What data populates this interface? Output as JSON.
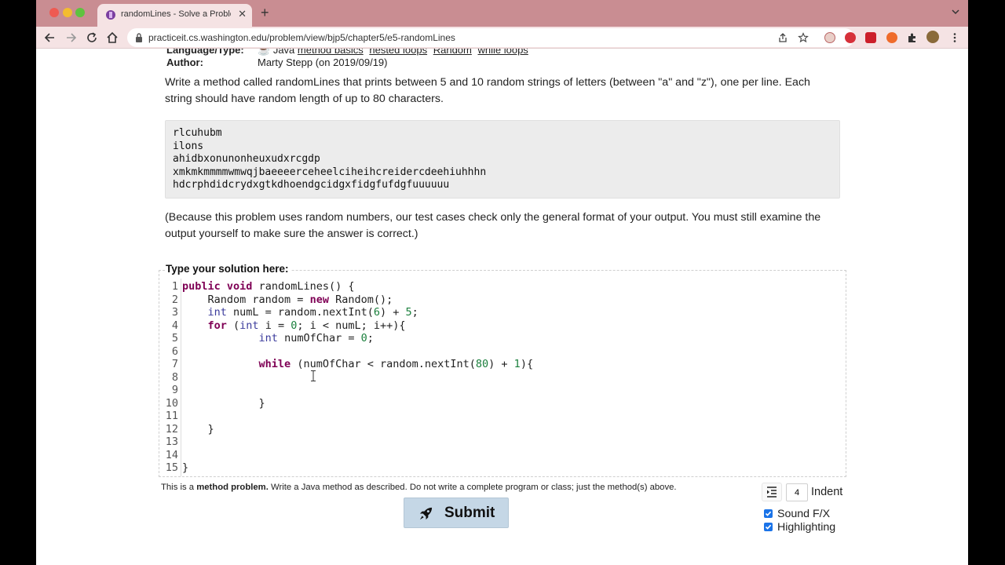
{
  "browser": {
    "tab_title": "randomLines - Solve a Problem",
    "tab_close": "✕",
    "new_tab": "+",
    "url": "practiceit.cs.washington.edu/problem/view/bjp5/chapter5/e5-randomLines",
    "icons": [
      "back-icon",
      "forward-icon",
      "reload-icon",
      "home-icon",
      "lock-icon",
      "share-icon",
      "star-icon",
      "extension-icons",
      "puzzle-icon",
      "profile-avatar",
      "kebab-menu-icon"
    ]
  },
  "problem": {
    "language_label": "Language/Type:",
    "language_value": "Java",
    "tags": [
      "method basics",
      "nested loops",
      "Random",
      "while loops"
    ],
    "author_label": "Author:",
    "author_value": "Marty Stepp (on 2019/09/19)",
    "description": "Write a method called randomLines that prints between 5 and 10 random strings of letters (between \"a\" and \"z\"), one per line. Each string should have random length of up to 80 characters.",
    "sample_output": [
      "rlcuhubm",
      "ilons",
      "ahidbxonunonheuxudxrcgdp",
      "xmkmkmmmmwmwqjbaeeeerceheelciheihcreidercdeehiuhhhn",
      "hdcrphdidcrydxgtkdhoendgcidgxfidgfufdgfuuuuuu"
    ],
    "note": "(Because this problem uses random numbers, our test cases check only the general format of your output. You must still examine the output yourself to make sure the answer is correct.)"
  },
  "editor": {
    "label": "Type your solution here:",
    "line_numbers": [
      "1",
      "2",
      "3",
      "4",
      "5",
      "6",
      "7",
      "8",
      "9",
      "10",
      "11",
      "12",
      "13",
      "14",
      "15"
    ],
    "code_lines": [
      "public void randomLines() {",
      "    Random random = new Random();",
      "    int numL = random.nextInt(6) + 5;",
      "    for (int i = 0; i < numL; i++){",
      "            int numOfChar = 0;",
      "",
      "            while (numOfChar < random.nextInt(80) + 1){",
      "",
      "",
      "            }",
      "",
      "    }",
      "",
      "",
      "}"
    ]
  },
  "footer": {
    "method_note_prefix": "This is a ",
    "method_note_bold": "method problem.",
    "method_note_rest": " Write a Java method as described. Do not write a complete program or class; just the method(s) above.",
    "submit_label": "Submit",
    "indent_value": "4",
    "indent_label": "Indent",
    "sound_fx_label": "Sound F/X",
    "sound_fx_checked": true,
    "highlighting_label": "Highlighting",
    "highlighting_checked": true
  },
  "colors": {
    "tabbar": "#c98d92",
    "toolbar": "#f5e3e4",
    "submit_bg": "#c5d7e6",
    "checkbox": "#1a73e8"
  }
}
